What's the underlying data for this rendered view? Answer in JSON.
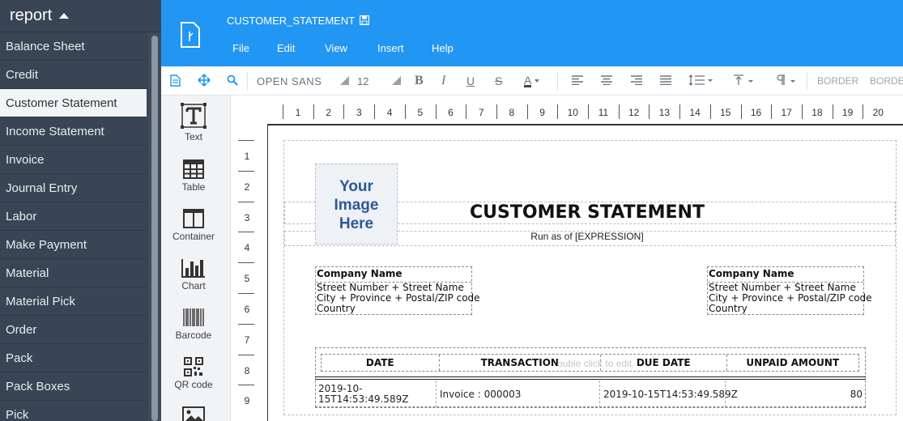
{
  "sidebar": {
    "header": "report",
    "items": [
      {
        "label": "Balance Sheet"
      },
      {
        "label": "Credit"
      },
      {
        "label": "Customer Statement",
        "active": true
      },
      {
        "label": "Income Statement"
      },
      {
        "label": "Invoice"
      },
      {
        "label": "Journal Entry"
      },
      {
        "label": "Labor"
      },
      {
        "label": "Make Payment"
      },
      {
        "label": "Material"
      },
      {
        "label": "Material Pick"
      },
      {
        "label": "Order"
      },
      {
        "label": "Pack"
      },
      {
        "label": "Pack Boxes"
      },
      {
        "label": "Pick"
      }
    ]
  },
  "header": {
    "doc_title": "CUSTOMER_STATEMENT",
    "menu": [
      "File",
      "Edit",
      "View",
      "Insert",
      "Help"
    ]
  },
  "toolbar": {
    "font": "OPEN SANS",
    "size": "12",
    "border1": "BORDER",
    "border2": "BORDE"
  },
  "components": [
    {
      "label": "Text",
      "icon": "text-icon"
    },
    {
      "label": "Table",
      "icon": "table-icon"
    },
    {
      "label": "Container",
      "icon": "container-icon"
    },
    {
      "label": "Chart",
      "icon": "chart-icon"
    },
    {
      "label": "Barcode",
      "icon": "barcode-icon"
    },
    {
      "label": "QR code",
      "icon": "qr-code-icon"
    }
  ],
  "ruler": {
    "h": [
      "1",
      "2",
      "3",
      "4",
      "5",
      "6",
      "7",
      "8",
      "9",
      "10",
      "11",
      "12",
      "13",
      "14",
      "15",
      "16",
      "17",
      "18",
      "19",
      "20"
    ],
    "v": [
      "1",
      "2",
      "3",
      "4",
      "5",
      "6",
      "7",
      "8",
      "9"
    ]
  },
  "report": {
    "image_placeholder": [
      "Your",
      "Image",
      "Here"
    ],
    "title": "CUSTOMER STATEMENT",
    "run_as": "Run as of [EXPRESSION]",
    "company_left": {
      "name": "Company Name",
      "lines": [
        "Street Number + Street Name",
        "City + Province + Postal/ZIP code",
        "Country"
      ]
    },
    "company_right": {
      "name": "Company Name",
      "lines": [
        "Street Number + Street Name",
        "City + Province + Postal/ZIP code",
        "Country"
      ]
    },
    "table": {
      "headers": [
        "DATE",
        "TRANSACTION",
        "DUE DATE",
        "UNPAID AMOUNT"
      ],
      "hint": "ouble click to edit",
      "row": [
        "2019-10-15T14:53:49.589Z",
        "Invoice : 000003",
        "2019-10-15T14:53:49.589Z",
        "80"
      ]
    }
  }
}
